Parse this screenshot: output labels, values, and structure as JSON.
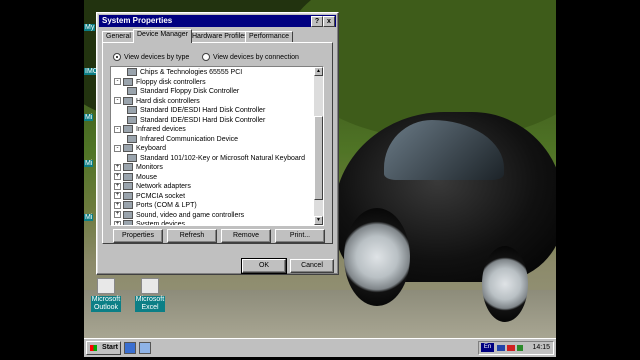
{
  "desktop": {
    "edge_labels": [
      "My",
      "IMC",
      "Mi",
      "Mi",
      "Mi"
    ],
    "icons": [
      {
        "label": "Microsoft Outlook",
        "line1": "Microsoft",
        "line2": "Outlook"
      },
      {
        "label": "Microsoft Excel",
        "line1": "Microsoft",
        "line2": "Excel"
      }
    ]
  },
  "dialog": {
    "title": "System Properties",
    "help_label": "?",
    "close_label": "x",
    "tabs": [
      "General",
      "Device Manager",
      "Hardware Profiles",
      "Performance"
    ],
    "active_tab": "Device Manager",
    "view_by_type": "View devices by type",
    "view_by_connection": "View devices by connection",
    "tree": [
      {
        "label": "Chips & Technologies 65555 PCI",
        "level": 1,
        "expander": ""
      },
      {
        "label": "Floppy disk controllers",
        "level": 0,
        "expander": "-"
      },
      {
        "label": "Standard Floppy Disk Controller",
        "level": 1,
        "expander": ""
      },
      {
        "label": "Hard disk controllers",
        "level": 0,
        "expander": "-"
      },
      {
        "label": "Standard IDE/ESDI Hard Disk Controller",
        "level": 1,
        "expander": ""
      },
      {
        "label": "Standard IDE/ESDI Hard Disk Controller",
        "level": 1,
        "expander": ""
      },
      {
        "label": "Infrared devices",
        "level": 0,
        "expander": "-"
      },
      {
        "label": "Infrared Communication Device",
        "level": 1,
        "expander": ""
      },
      {
        "label": "Keyboard",
        "level": 0,
        "expander": "-"
      },
      {
        "label": "Standard 101/102-Key or Microsoft Natural Keyboard",
        "level": 1,
        "expander": ""
      },
      {
        "label": "Monitors",
        "level": 0,
        "expander": "+"
      },
      {
        "label": "Mouse",
        "level": 0,
        "expander": "+"
      },
      {
        "label": "Network adapters",
        "level": 0,
        "expander": "+"
      },
      {
        "label": "PCMCIA socket",
        "level": 0,
        "expander": "+"
      },
      {
        "label": "Ports (COM & LPT)",
        "level": 0,
        "expander": "+"
      },
      {
        "label": "Sound, video and game controllers",
        "level": 0,
        "expander": "+"
      },
      {
        "label": "System devices",
        "level": 0,
        "expander": "+"
      }
    ],
    "buttons": {
      "properties": "Properties",
      "refresh": "Refresh",
      "remove": "Remove",
      "print": "Print...",
      "ok": "OK",
      "cancel": "Cancel"
    }
  },
  "taskbar": {
    "start": "Start",
    "lang": "En",
    "clock": "14:15"
  },
  "colors": {
    "title_bar": "#000080",
    "face": "#c0c0c0",
    "icon_label_bg": "#0c7f86"
  }
}
